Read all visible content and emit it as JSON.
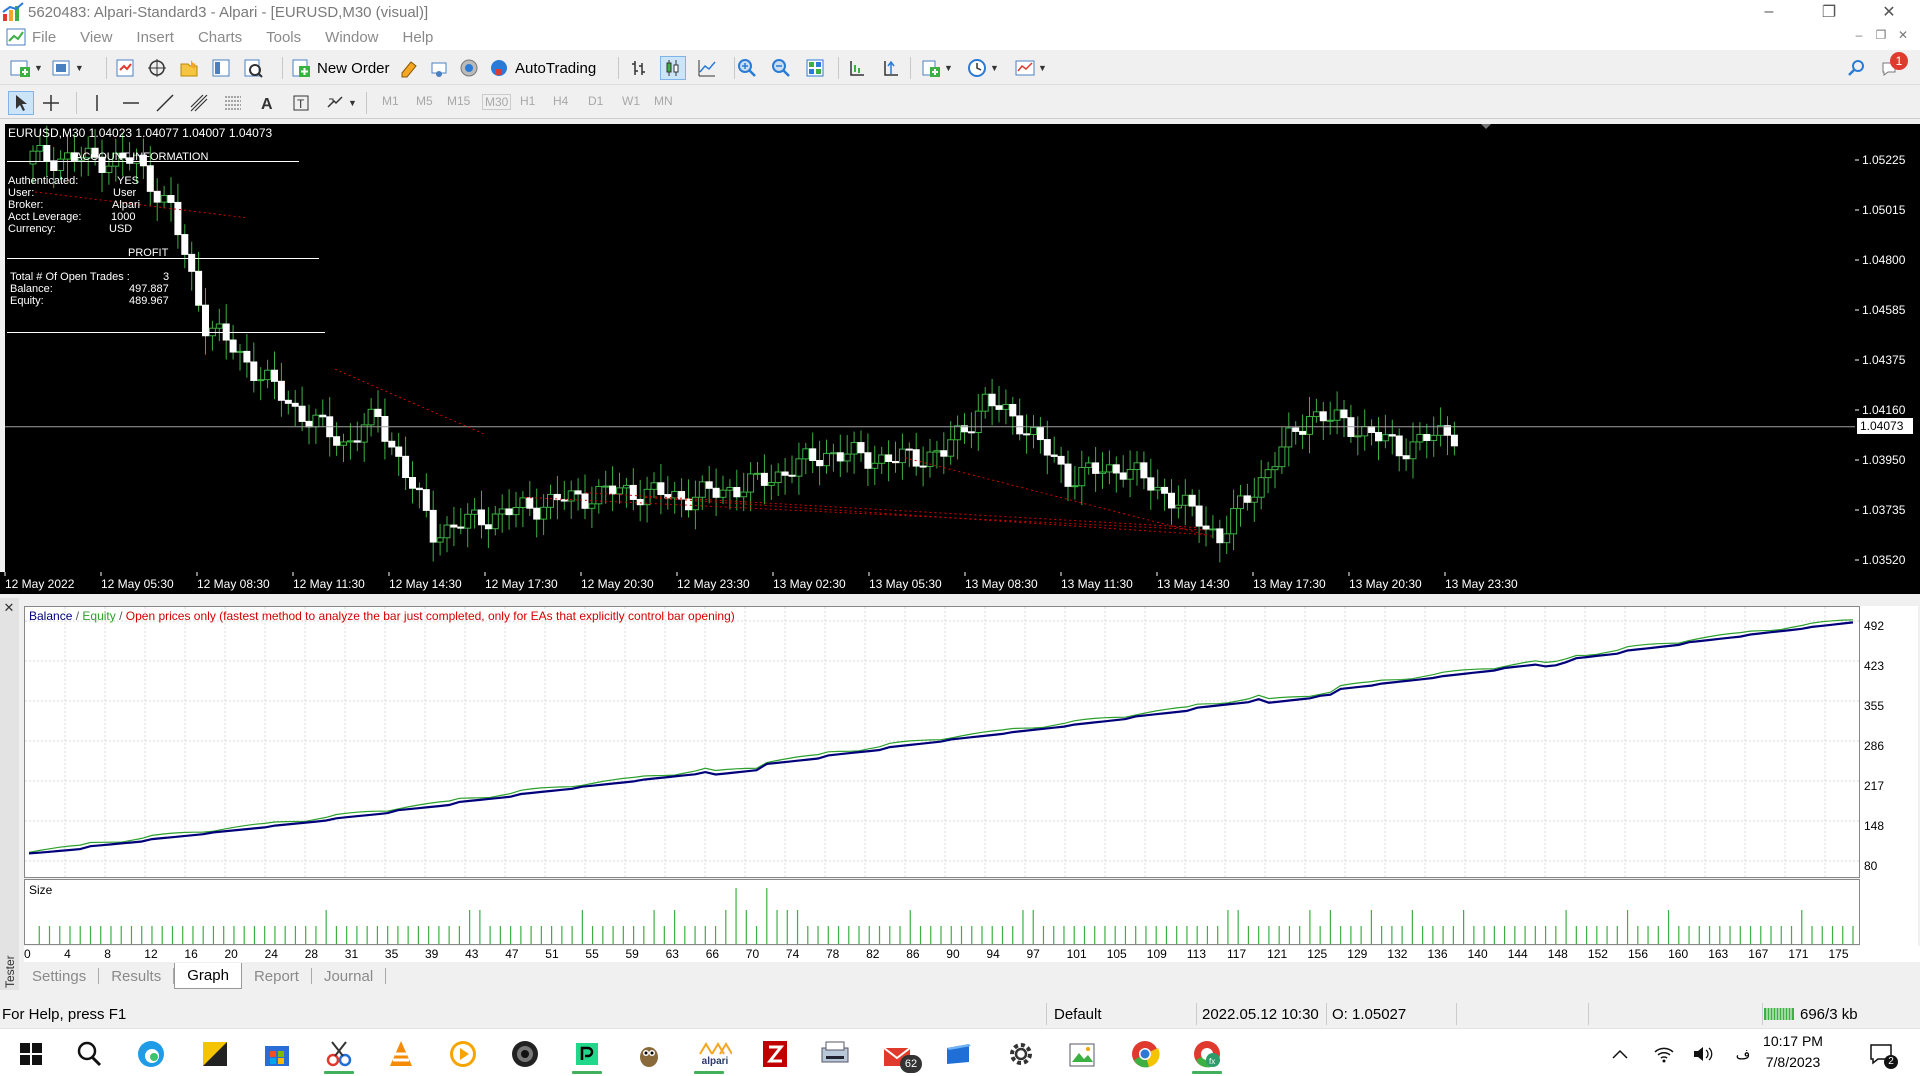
{
  "window": {
    "title": "5620483: Alpari-Standard3 - Alpari - [EURUSD,M30 (visual)]",
    "minimize": "–",
    "restore": "❐",
    "close": "✕"
  },
  "menu": [
    "File",
    "View",
    "Insert",
    "Charts",
    "Tools",
    "Window",
    "Help"
  ],
  "toolbar": {
    "new_order": "New Order",
    "autotrading": "AutoTrading",
    "notification_count": "1",
    "timeframes": [
      "M1",
      "M5",
      "M15",
      "M30",
      "H1",
      "H4",
      "D1",
      "W1",
      "MN"
    ],
    "active_timeframe": "M30"
  },
  "chart": {
    "symbol_line": "EURUSD,M30  1.04023 1.04077 1.04007 1.04073",
    "current_price": "1.04073",
    "price_labels": [
      "1.05225",
      "1.05015",
      "1.04800",
      "1.04585",
      "1.04375",
      "1.04160",
      "1.03950",
      "1.03735",
      "1.03520"
    ],
    "time_labels": [
      "12 May 2022",
      "12 May 05:30",
      "12 May 08:30",
      "12 May 11:30",
      "12 May 14:30",
      "12 May 17:30",
      "12 May 20:30",
      "12 May 23:30",
      "13 May 02:30",
      "13 May 05:30",
      "13 May 08:30",
      "13 May 11:30",
      "13 May 14:30",
      "13 May 17:30",
      "13 May 20:30",
      "13 May 23:30"
    ],
    "account_info": {
      "header": "ACCOUNT INFORMATION",
      "authenticated_label": "Authenticated:",
      "authenticated_value": "YES",
      "user_label": "User:",
      "user_value": "User",
      "broker_label": "Broker:",
      "broker_value": "Alpari",
      "leverage_label": "Acct Leverage:",
      "leverage_value": "1000",
      "currency_label": "Currency:",
      "currency_value": "USD",
      "profit_header": "PROFIT",
      "trades_label": "Total # Of Open Trades :",
      "trades_value": "3",
      "balance_label": "Balance:",
      "balance_value": "497.887",
      "equity_label": "Equity:",
      "equity_value": "489.967"
    }
  },
  "tester": {
    "side_label": "Tester",
    "legend_balance": "Balance",
    "legend_sep": " / ",
    "legend_equity": "Equity",
    "legend_mode": "Open prices only (fastest method to analyze the bar just completed, only for EAs that explicitly control bar opening)",
    "size_label": "Size",
    "y_labels": [
      "492",
      "423",
      "355",
      "286",
      "217",
      "148",
      "80"
    ],
    "x_labels": [
      "0",
      "4",
      "8",
      "12",
      "16",
      "20",
      "24",
      "28",
      "31",
      "35",
      "39",
      "43",
      "47",
      "51",
      "55",
      "59",
      "63",
      "66",
      "70",
      "74",
      "78",
      "82",
      "86",
      "90",
      "94",
      "97",
      "101",
      "105",
      "109",
      "113",
      "117",
      "121",
      "125",
      "129",
      "132",
      "136",
      "140",
      "144",
      "148",
      "152",
      "156",
      "160",
      "163",
      "167",
      "171",
      "175"
    ],
    "tabs": [
      "Settings",
      "Results",
      "Graph",
      "Report",
      "Journal"
    ],
    "active_tab": "Graph",
    "colors": {
      "balance": "#00007a",
      "equity": "#2ca02c",
      "mode": "#d40000",
      "volume": "#3cb043"
    }
  },
  "status": {
    "help": "For Help, press F1",
    "profile": "Default",
    "datetime": "2022.05.12 10:30",
    "open": "O: 1.05027",
    "traffic": "696/3 kb"
  },
  "taskbar": {
    "icons": [
      "windows-start",
      "search",
      "edge",
      "sticky-notes",
      "microsoft-store",
      "snipping-tool",
      "vlc",
      "media-player",
      "camera",
      "pycharm",
      "gimp",
      "alpari",
      "filezilla",
      "scanner",
      "mail",
      "file-explorer",
      "settings",
      "photo-editor",
      "chrome",
      "metatrader"
    ],
    "mail_badge": "62",
    "alpari_label": "alpari",
    "lang": "ف",
    "time": "10:17 PM",
    "date": "7/8/2023",
    "notification_count": "2"
  }
}
